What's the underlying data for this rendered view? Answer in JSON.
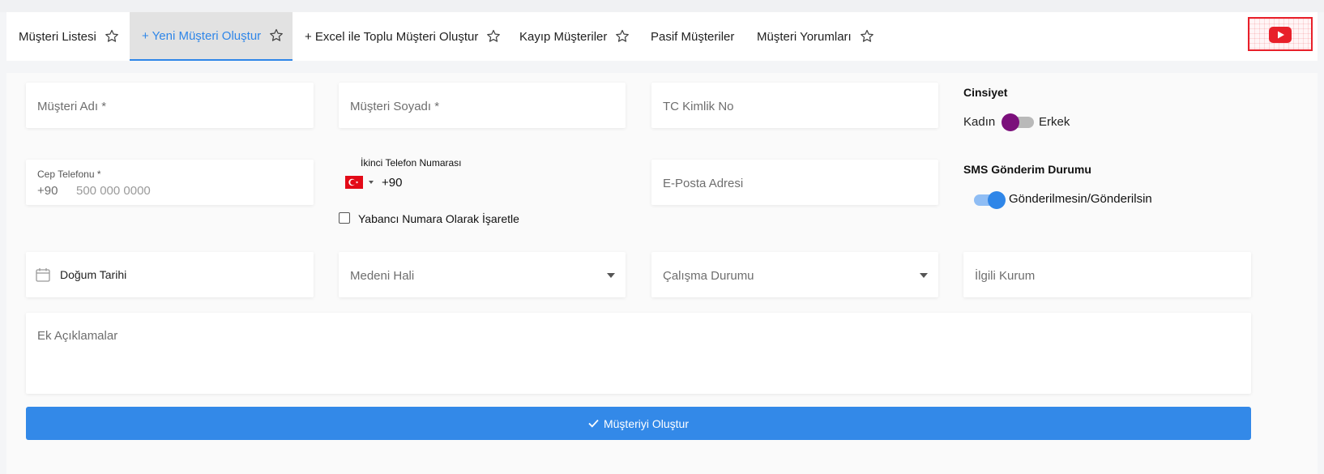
{
  "tabs": [
    {
      "label": "Müşteri Listesi"
    },
    {
      "label": "+ Yeni Müşteri Oluştur"
    },
    {
      "label": "+ Excel ile Toplu Müşteri Oluştur"
    },
    {
      "label": "Kayıp Müşteriler"
    },
    {
      "label": "Pasif Müşteriler"
    },
    {
      "label": "Müşteri Yorumları"
    }
  ],
  "active_tab": "+ Yeni Müşteri Oluştur",
  "form": {
    "first_name": {
      "placeholder": "Müşteri Adı *"
    },
    "last_name": {
      "placeholder": "Müşteri Soyadı *"
    },
    "tc_no": {
      "placeholder": "TC Kimlik No"
    },
    "gender": {
      "label": "Cinsiyet",
      "left": "Kadın",
      "right": "Erkek"
    },
    "mobile": {
      "label": "Cep Telefonu *",
      "prefix": "+90",
      "placeholder": "500 000 0000"
    },
    "second_phone": {
      "label": "İkinci Telefon Numarası",
      "code": "+90"
    },
    "foreign_number": {
      "label": "Yabancı Numara Olarak İşaretle"
    },
    "email": {
      "placeholder": "E-Posta Adresi"
    },
    "sms": {
      "label": "SMS Gönderim Durumu",
      "value": "Gönderilmesin/Gönderilsin"
    },
    "birth_date": {
      "placeholder": "Doğum Tarihi"
    },
    "marital": {
      "placeholder": "Medeni Hali"
    },
    "employment": {
      "placeholder": "Çalışma Durumu"
    },
    "institution": {
      "placeholder": "İlgili Kurum"
    },
    "notes": {
      "placeholder": "Ek Açıklamalar"
    },
    "submit": {
      "label": "Müşteriyi Oluştur"
    }
  },
  "colors": {
    "accent": "#2f86e8",
    "submit": "#3389e8",
    "gender_knob": "#7b0f7b",
    "youtube_red": "#e8202a"
  },
  "icons": [
    "star-icon",
    "youtube-icon",
    "calendar-icon",
    "turkey-flag-icon",
    "check-icon",
    "chevron-down-icon"
  ]
}
